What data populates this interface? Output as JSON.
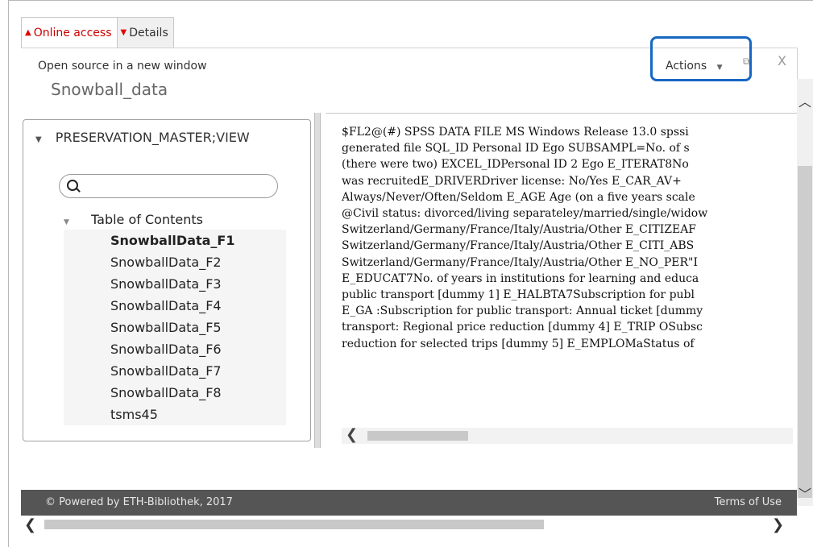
{
  "tabs": [
    {
      "label": "Online access",
      "active": true
    },
    {
      "label": "Details",
      "active": false
    }
  ],
  "header": {
    "open_link": "Open source in a new window",
    "actions_label": "Actions",
    "actions_caret": "▼",
    "external_icon": "⧉",
    "close_icon": "X"
  },
  "source_title": "Snowball_data",
  "left_panel": {
    "view_label": "PRESERVATION_MASTER;VIEW",
    "search_placeholder": "",
    "toc_label": "Table of Contents",
    "items": [
      {
        "label": "SnowballData_F1",
        "selected": true
      },
      {
        "label": "SnowballData_F2",
        "selected": false
      },
      {
        "label": "SnowballData_F3",
        "selected": false
      },
      {
        "label": "SnowballData_F4",
        "selected": false
      },
      {
        "label": "SnowballData_F5",
        "selected": false
      },
      {
        "label": "SnowballData_F6",
        "selected": false
      },
      {
        "label": "SnowballData_F7",
        "selected": false
      },
      {
        "label": "SnowballData_F8",
        "selected": false
      },
      {
        "label": "tsms45",
        "selected": false
      }
    ]
  },
  "document_lines": [
    "$FL2@(#) SPSS DATA FILE MS Windows Release 13.0 spssi",
    "generated file SQL_ID Personal ID Ego SUBSAMPL=No. of s",
    "(there were two) EXCEL_IDPersonal ID 2 Ego E_ITERAT8No",
    "was recruitedE_DRIVERDriver license: No/Yes E_CAR_AV+",
    "Always/Never/Often/Seldom E_AGE Age (on a five years scale",
    "@Civil status: divorced/living separateley/married/single/widow",
    "Switzerland/Germany/France/Italy/Austria/Other E_CITIZEAF",
    "Switzerland/Germany/France/Italy/Austria/Other E_CITI_ABS",
    "Switzerland/Germany/France/Italy/Austria/Other E_NO_PER\"I",
    "E_EDUCAT7No. of years in institutions for learning and educa",
    "public transport [dummy 1] E_HALBTA7Subscription for publ",
    "E_GA :Subscription for public transport: Annual ticket [dummy",
    "transport: Regional price reduction [dummy 4] E_TRIP OSubsc",
    "reduction for selected trips [dummy 5] E_EMPLOMaStatus of"
  ],
  "footer": {
    "copyright": "© Powered by ETH-Bibliothek, 2017",
    "terms": "Terms of Use"
  }
}
